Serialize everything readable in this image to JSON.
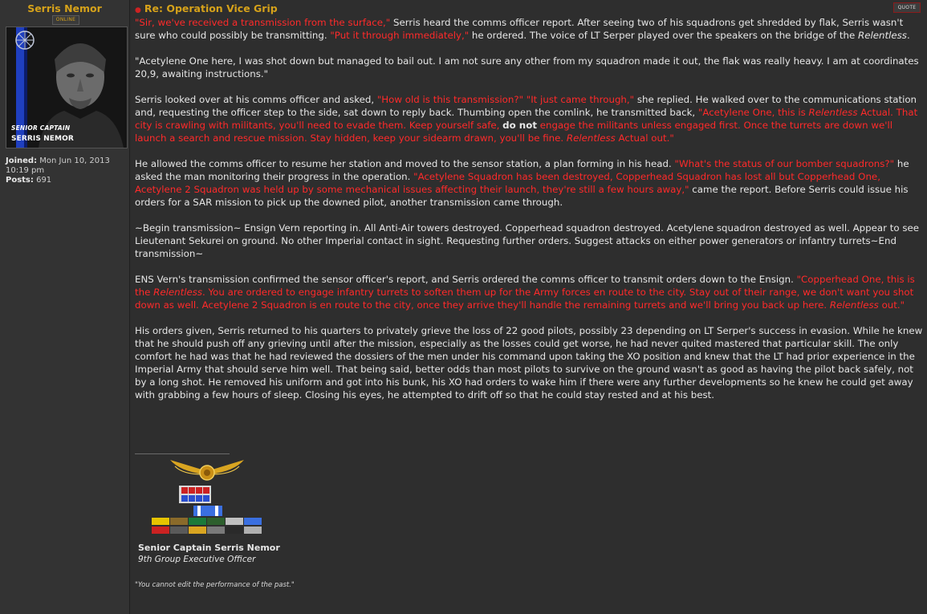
{
  "profile": {
    "username": "Serris Nemor",
    "status": "ONLINE",
    "avatar_rank": "SENIOR CAPTAIN",
    "avatar_name": "SERRIS NEMOR",
    "joined_label": "Joined:",
    "joined_value": "Mon Jun 10, 2013 10:19 pm",
    "posts_label": "Posts:",
    "posts_value": "691"
  },
  "post": {
    "title": "Re: Operation Vice Grip",
    "quote_label": "QUOTE",
    "p1": {
      "a": "\"Sir, we've received a transmission from the surface,\"",
      "b": " Serris heard the comms officer report. After seeing two of his squadrons get shredded by flak, Serris wasn't sure who could possibly be transmitting. ",
      "c": "\"Put it through immediately,\"",
      "d": " he ordered. The voice of LT Serper played over the speakers on the bridge of the ",
      "e": "Relentless",
      "f": "."
    },
    "p2": "\"Acetylene One here, I was shot down but managed to bail out. I am not sure any other from my squadron made it out, the flak was really heavy. I am at coordinates 20,9, awaiting instructions.\"",
    "p3": {
      "a": "Serris looked over at his comms officer and asked, ",
      "b": "\"How old is this transmission?\"",
      "c": " ",
      "d": "\"It just came through,\"",
      "e": " she replied. He walked over to the communications station and, requesting the officer step to the side, sat down to reply back. Thumbing open the comlink, he transmitted back, ",
      "f": "\"Acetylene One, this is ",
      "g": "Relentless",
      "h": " Actual. That city is crawling with militants, you'll need to evade them. Keep yourself safe, ",
      "i": "do not",
      "j": " engage the militants unless engaged first. Once the turrets are down we'll launch a search and rescue mission. Stay hidden, keep your sidearm drawn, you'll be fine. ",
      "k": "Relentless",
      "l": " Actual out.\""
    },
    "p4": {
      "a": "He allowed the comms officer to resume her station and moved to the sensor station, a plan forming in his head. ",
      "b": "\"What's the status of our bomber squadrons?\"",
      "c": " he asked the man monitoring their progress in the operation. ",
      "d": "\"Acetylene Squadron has been destroyed, Copperhead Squadron has lost all but Copperhead One, Acetylene 2 Squadron was held up by some mechanical issues affecting their launch, they're still a few hours away,\"",
      "e": " came the report. Before Serris could issue his orders for a SAR mission to pick up the downed pilot, another transmission came through."
    },
    "p5": "~Begin transmission~ Ensign Vern reporting in. All Anti-Air towers destroyed. Copperhead squadron destroyed. Acetylene squadron destroyed as well. Appear to see Lieutenant Sekurei on ground. No other Imperial contact in sight. Requesting further orders. Suggest attacks on either power generators or infantry turrets~End transmission~",
    "p6": {
      "a": "ENS Vern's transmission confirmed the sensor officer's report, and Serris ordered the comms officer to transmit orders down to the Ensign. ",
      "b": "\"Copperhead One, this is the ",
      "c": "Relentless",
      "d": ". You are ordered to engage infantry turrets to soften them up for the Army forces en route to the city. Stay out of their range, we don't want you shot down as well. Acetylene 2 Squadron is en route to the city, once they arrive they'll handle the remaining turrets and we'll bring you back up here. ",
      "e": "Relentless",
      "f": " out.\""
    },
    "p7": "His orders given, Serris returned to his quarters to privately grieve the loss of 22 good pilots, possibly 23 depending on LT Serper's success in evasion. While he knew that he should push off any grieving until after the mission, especially as the losses could get worse, he had never quited mastered that particular skill. The only comfort he had was that he had reviewed the dossiers of the men under his command upon taking the XO position and knew that the LT had prior experience in the Imperial Army that should serve him well. That being said, better odds than most pilots to survive on the ground wasn't as good as having the pilot back safely, not by a long shot. He removed his uniform and got into his bunk, his XO had orders to wake him if there were any further developments so he knew he could get away with grabbing a few hours of sleep. Closing his eyes, he attempted to drift off so that he could stay rested and at his best."
  },
  "signature": {
    "name": "Senior Captain Serris Nemor",
    "position": "9th Group Executive Officer",
    "quote": "\"You cannot edit the performance of the past.\""
  },
  "colors": {
    "username": "#d6a21a",
    "dialogue": "#ff2a2a",
    "background": "#2e2e2e"
  }
}
